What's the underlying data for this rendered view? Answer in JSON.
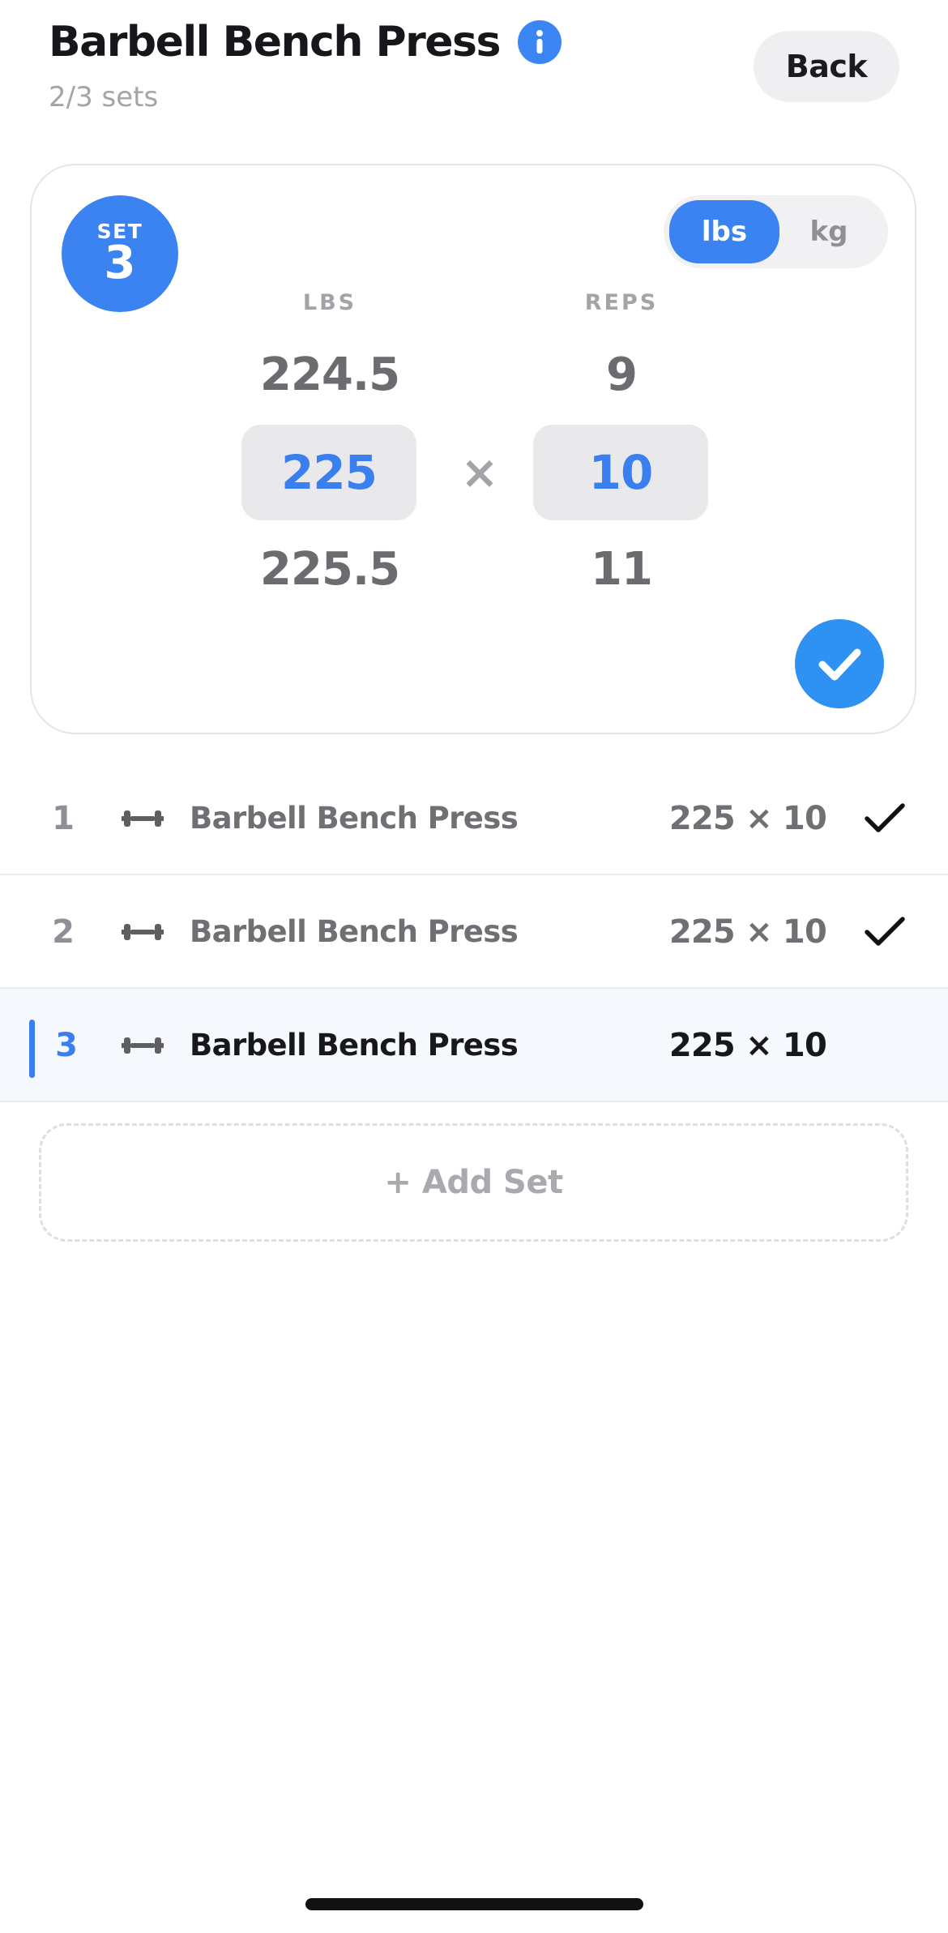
{
  "header": {
    "title": "Barbell Bench Press",
    "subtitle": "2/3 sets",
    "back_label": "Back",
    "info_icon": "info-icon"
  },
  "set_card": {
    "badge_label": "SET",
    "badge_number": "3",
    "units": {
      "options": [
        "lbs",
        "kg"
      ],
      "selected": "lbs"
    },
    "weight_column": {
      "label": "LBS",
      "above": "224.5",
      "selected": "225",
      "below": "225.5"
    },
    "reps_column": {
      "label": "REPS",
      "above": "9",
      "selected": "10",
      "below": "11"
    },
    "times_symbol": "×",
    "confirm_icon": "checkmark-icon"
  },
  "sets": [
    {
      "number": "1",
      "name": "Barbell Bench Press",
      "value": "225 × 10",
      "completed": true,
      "current": false
    },
    {
      "number": "2",
      "name": "Barbell Bench Press",
      "value": "225 × 10",
      "completed": true,
      "current": false
    },
    {
      "number": "3",
      "name": "Barbell Bench Press",
      "value": "225 × 10",
      "completed": false,
      "current": true
    }
  ],
  "add_set_label": "+ Add Set",
  "colors": {
    "accent": "#3a83f1",
    "confirm": "#2f92f3",
    "muted_text": "#6f6f74",
    "current_row_bg": "#f5f8fd"
  }
}
